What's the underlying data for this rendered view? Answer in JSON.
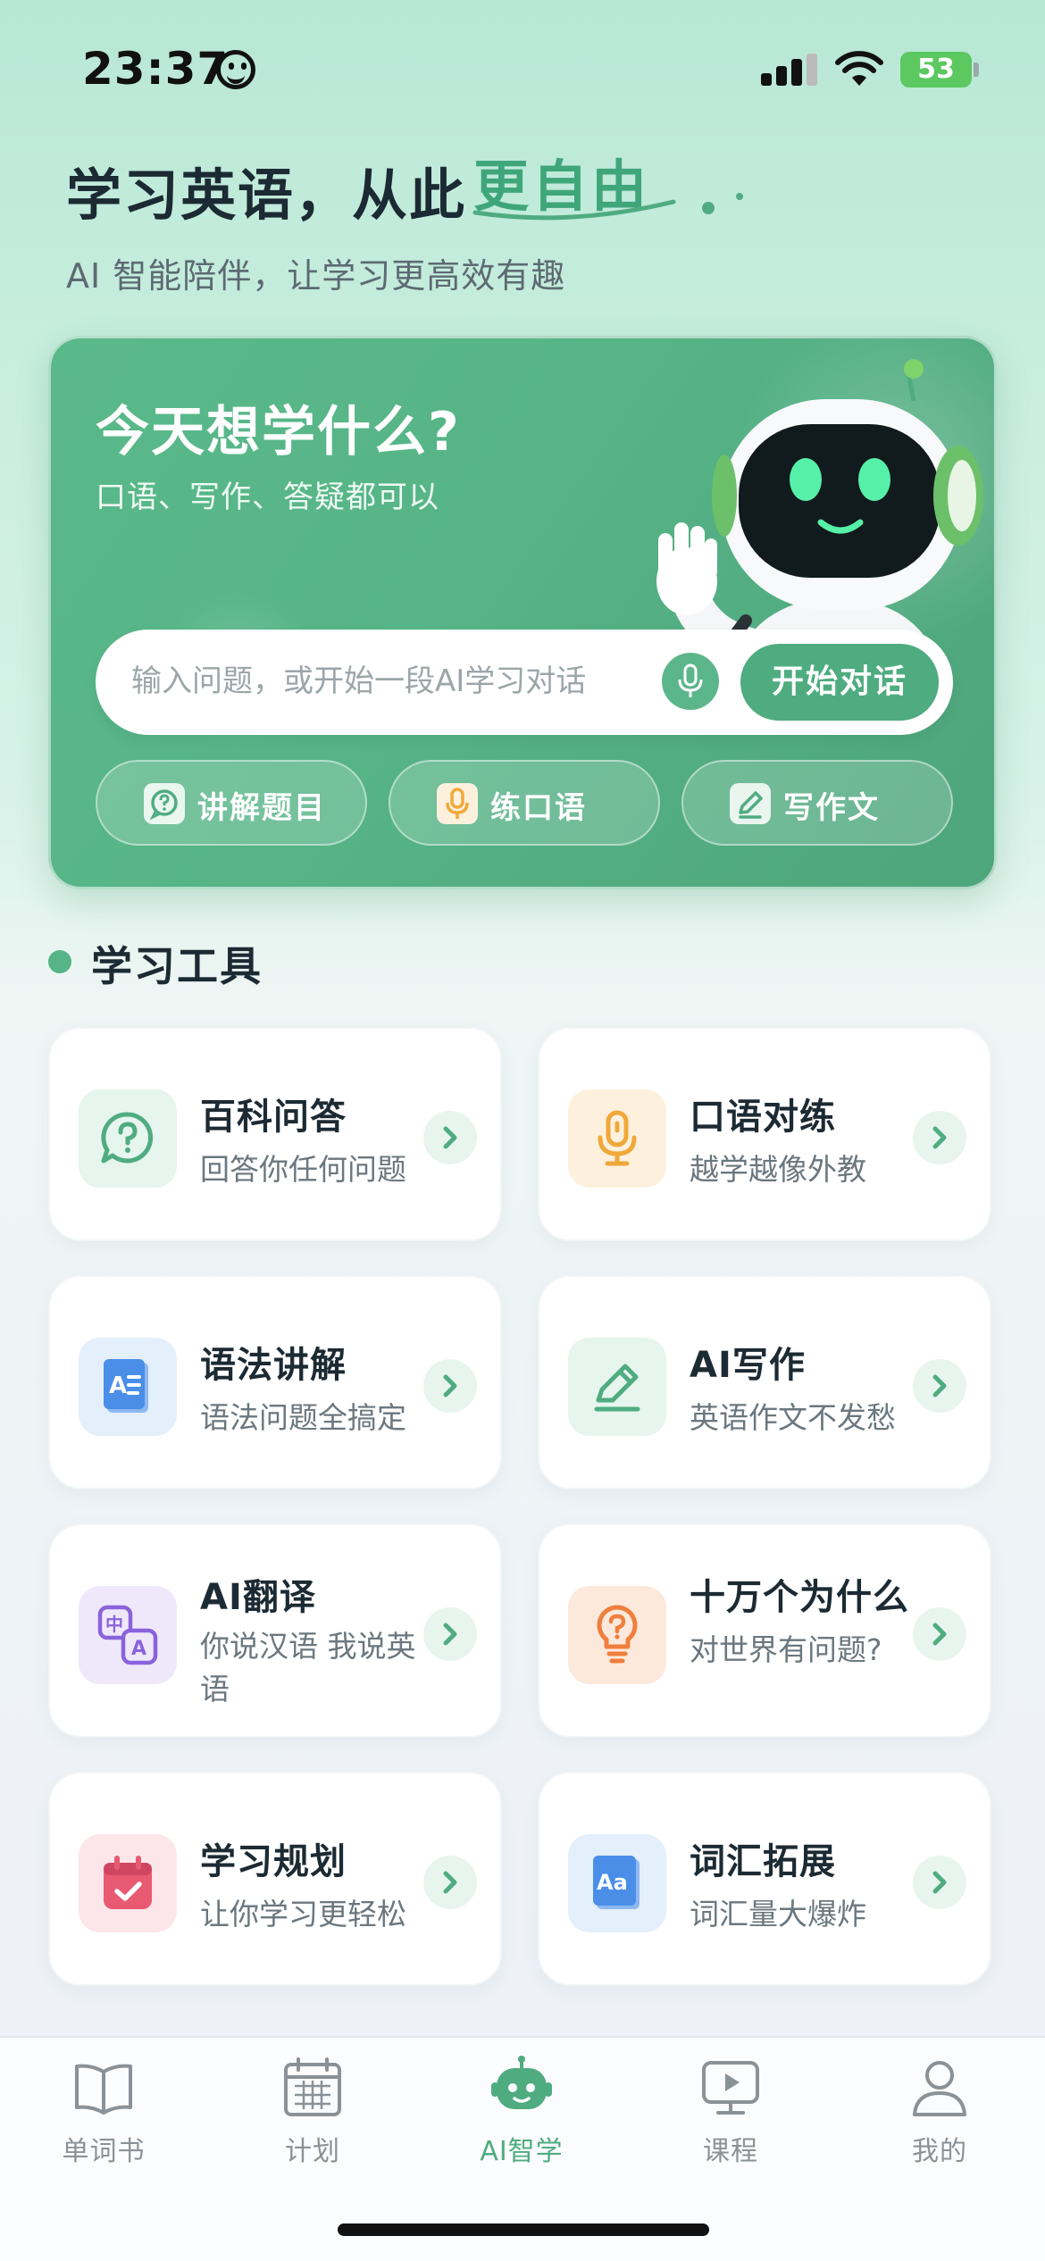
{
  "status_bar": {
    "time": "23:37",
    "battery": "53"
  },
  "header": {
    "title": "学习英语，从此",
    "title_accent": "更自由",
    "subtitle": "AI 智能陪伴，让学习更高效有趣"
  },
  "ai_card": {
    "title": "今天想学什么?",
    "subtitle": "口语、写作、答疑都可以",
    "input_placeholder": "输入问题，或开始一段AI学习对话",
    "start_label": "开始对话",
    "quick_actions": [
      {
        "label": "讲解题目",
        "icon": "question-chat-icon"
      },
      {
        "label": "练口语",
        "icon": "microphone-icon"
      },
      {
        "label": "写作文",
        "icon": "pencil-icon"
      }
    ]
  },
  "tools_section": {
    "title": "学习工具",
    "items": [
      {
        "name": "百科问答",
        "desc": "回答你任何问题",
        "icon": "question-bubble-icon",
        "color": "#4fac80",
        "bg": "#e6f5ee"
      },
      {
        "name": "口语对练",
        "desc": "越学越像外教",
        "icon": "microphone-icon",
        "color": "#f0a83a",
        "bg": "#fdf1de"
      },
      {
        "name": "语法讲解",
        "desc": "语法问题全搞定",
        "icon": "grammar-doc-icon",
        "color": "#4a8ee8",
        "bg": "#e4effc"
      },
      {
        "name": "AI写作",
        "desc": "英语作文不发愁",
        "icon": "pencil-icon",
        "color": "#4fac80",
        "bg": "#e6f5ee"
      },
      {
        "name": "AI翻译",
        "desc": "你说汉语 我说英语",
        "icon": "translate-icon",
        "color": "#8a63dc",
        "bg": "#efe8fb"
      },
      {
        "name": "十万个为什么",
        "desc": "对世界有问题?",
        "icon": "lightbulb-question-icon",
        "color": "#f07e3c",
        "bg": "#fde9dc"
      },
      {
        "name": "学习规划",
        "desc": "让你学习更轻松",
        "icon": "calendar-check-icon",
        "color": "#e85a72",
        "bg": "#fce6ea"
      },
      {
        "name": "词汇拓展",
        "desc": "词汇量大爆炸",
        "icon": "vocabulary-book-icon",
        "color": "#4a8ee8",
        "bg": "#e4effc"
      }
    ]
  },
  "tab_bar": {
    "tabs": [
      {
        "label": "单词书",
        "icon": "open-book-icon",
        "active": false
      },
      {
        "label": "计划",
        "icon": "calendar-icon",
        "active": false
      },
      {
        "label": "AI智学",
        "icon": "robot-icon",
        "active": true
      },
      {
        "label": "课程",
        "icon": "video-course-icon",
        "active": false
      },
      {
        "label": "我的",
        "icon": "person-icon",
        "active": false
      }
    ]
  },
  "colors": {
    "brand": "#4fac80",
    "brand_light": "#5ab98a",
    "text_primary": "#1c2a33",
    "text_secondary": "#6b777e"
  }
}
